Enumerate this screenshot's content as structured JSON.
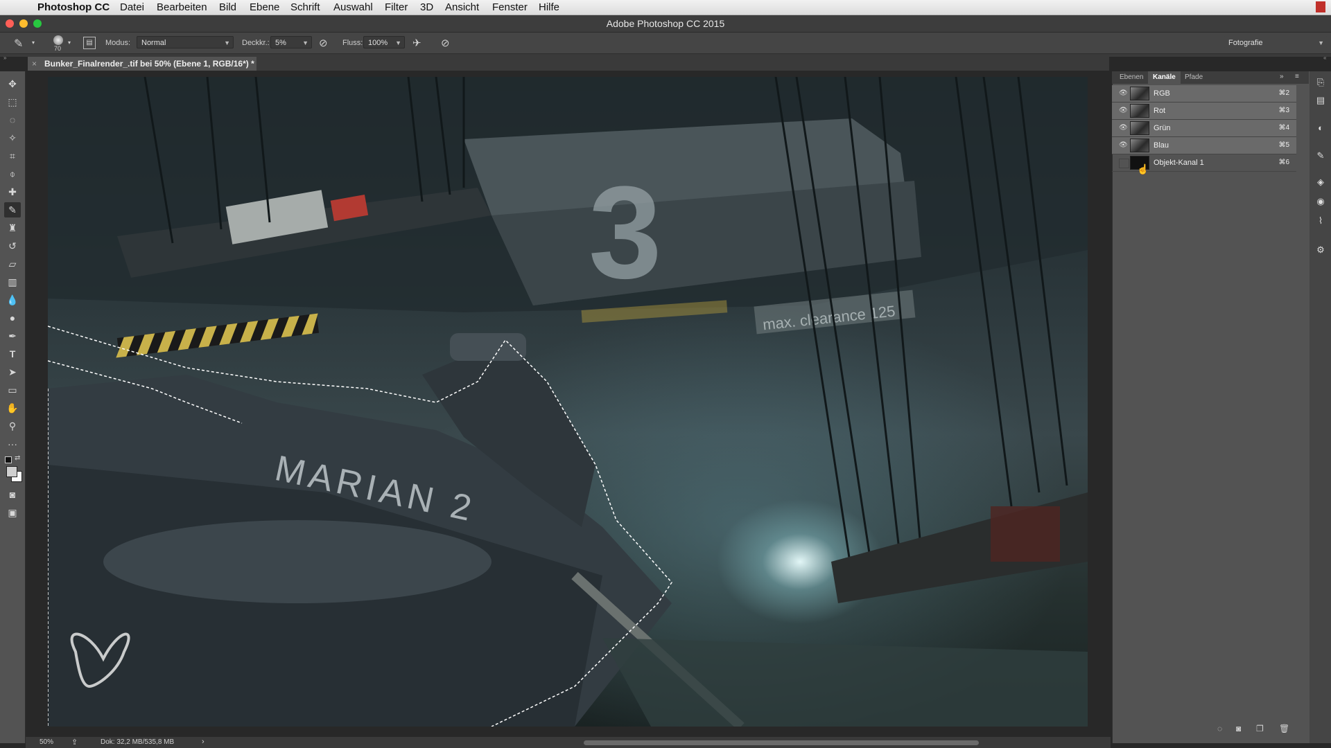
{
  "menubar": {
    "app_name": "Photoshop CC",
    "items": [
      "Datei",
      "Bearbeiten",
      "Bild",
      "Ebene",
      "Schrift",
      "Auswahl",
      "Filter",
      "3D",
      "Ansicht",
      "Fenster",
      "Hilfe"
    ]
  },
  "titlebar": {
    "title": "Adobe Photoshop CC 2015"
  },
  "options": {
    "brush_size": "70",
    "mode_label": "Modus:",
    "mode_value": "Normal",
    "opacity_label": "Deckkr.:",
    "opacity_value": "5%",
    "flow_label": "Fluss:",
    "flow_value": "100%",
    "workspace": "Fotografie"
  },
  "document": {
    "tab_title": "Bunker_Finalrender_.tif bei 50% (Ebene 1, RGB/16*) *",
    "close_glyph": "×"
  },
  "canvas_text": {
    "hull_name": "MARIAN 2",
    "clearance_sign": "max. clearance 125",
    "number_sign": "3"
  },
  "status": {
    "zoom": "50%",
    "doc_size": "Dok: 32,2 MB/535,8 MB",
    "arrow": "›"
  },
  "panel": {
    "tabs": [
      "Ebenen",
      "Kanäle",
      "Pfade"
    ],
    "active_tab": "Kanäle",
    "channels": [
      {
        "name": "RGB",
        "shortcut": "⌘2",
        "visible": true
      },
      {
        "name": "Rot",
        "shortcut": "⌘3",
        "visible": true
      },
      {
        "name": "Grün",
        "shortcut": "⌘4",
        "visible": true
      },
      {
        "name": "Blau",
        "shortcut": "⌘5",
        "visible": true
      },
      {
        "name": "Objekt-Kanal 1",
        "shortcut": "⌘6",
        "visible": false
      }
    ]
  },
  "colors": {
    "accent_close": "#ff5f57",
    "accent_min": "#febc2e",
    "accent_max": "#28c840",
    "selected_row": "#6a6a6a"
  }
}
